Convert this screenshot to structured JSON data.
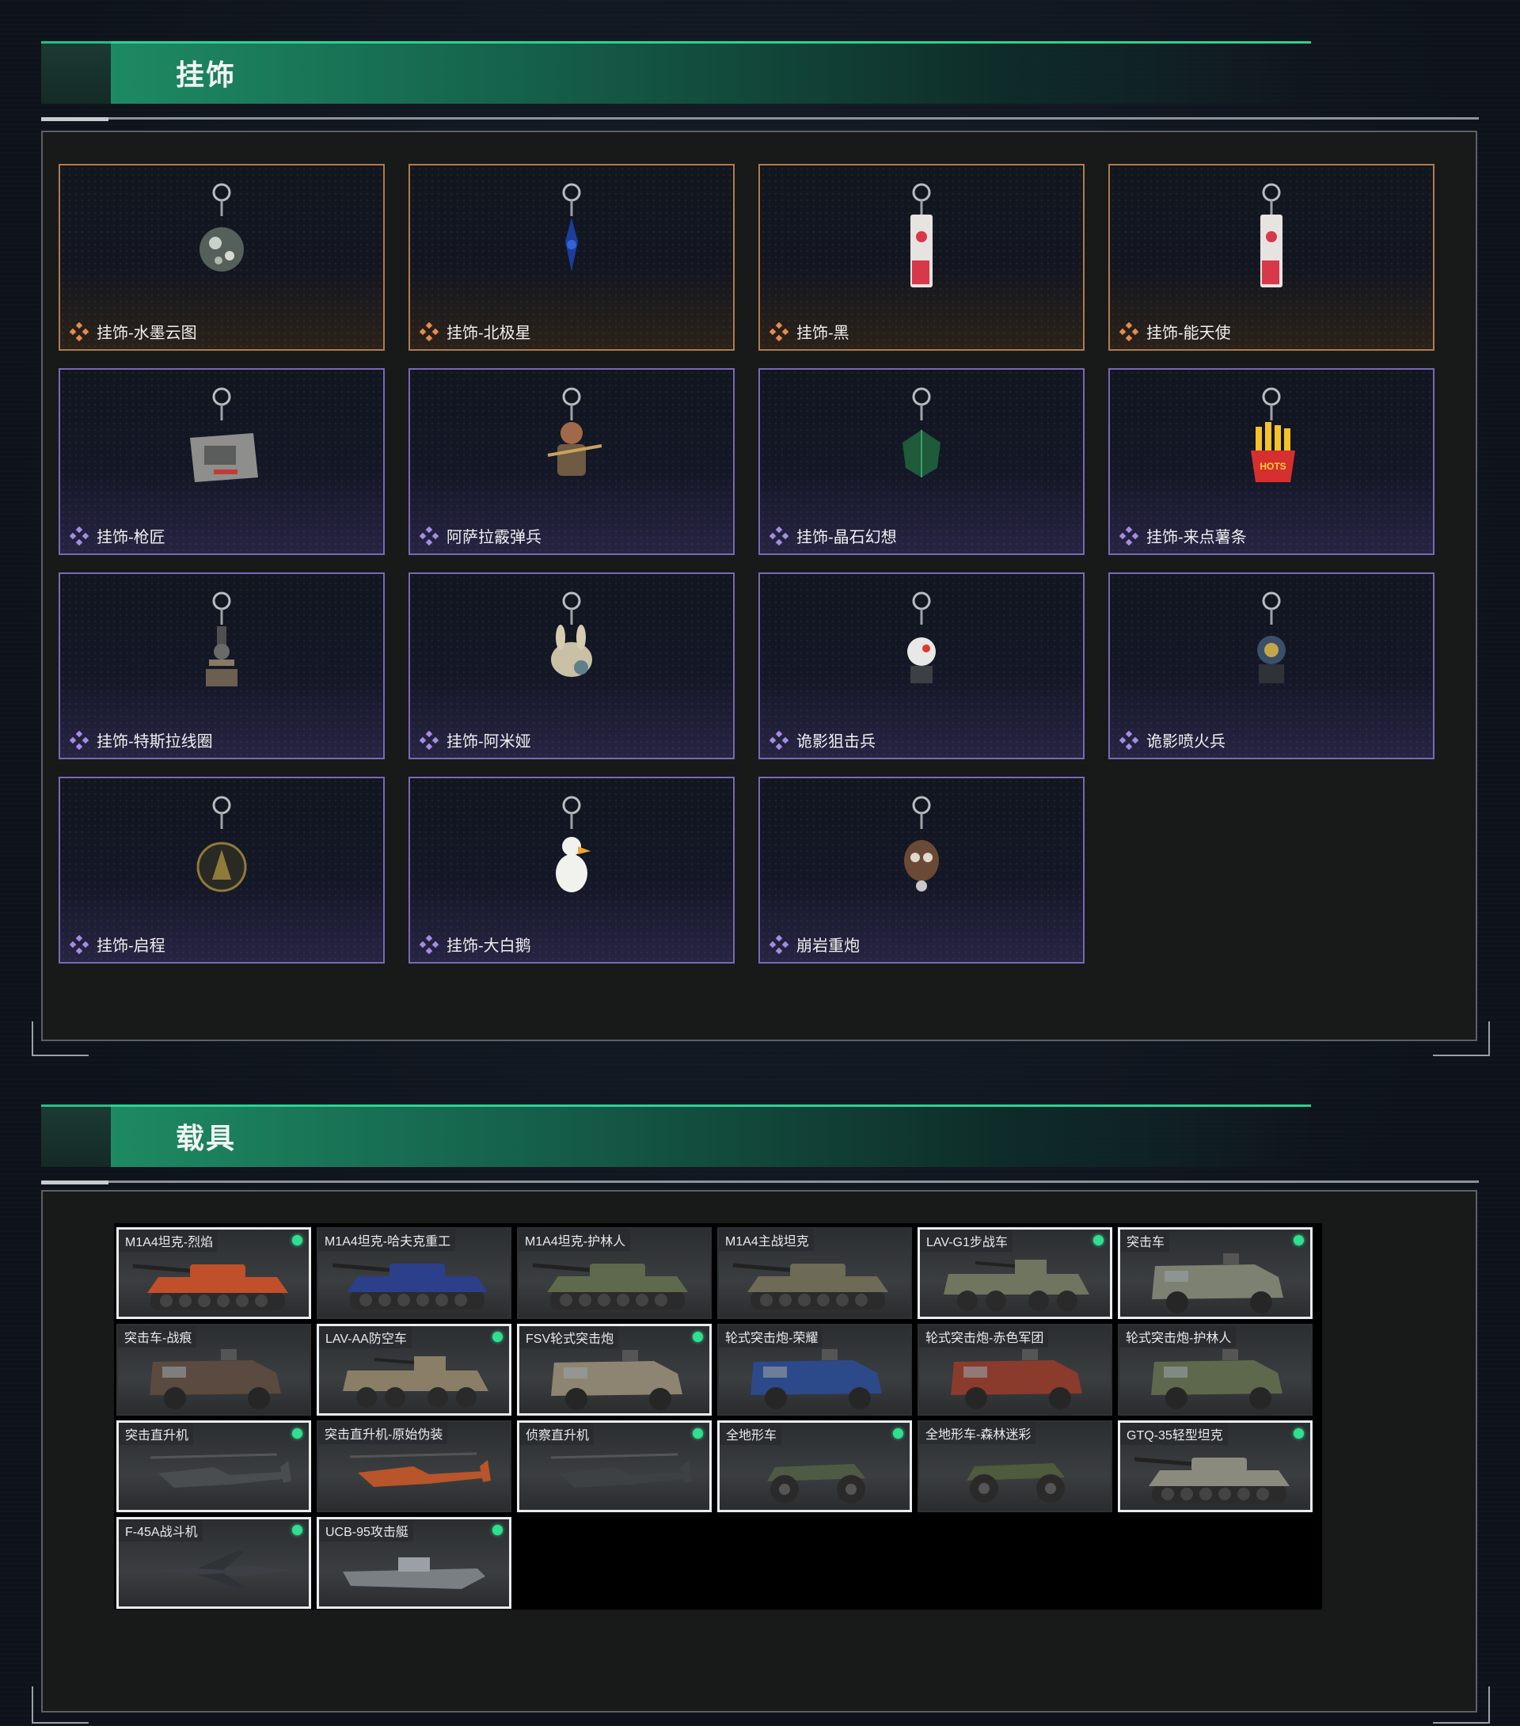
{
  "sections": {
    "pendants": {
      "title": "挂饰"
    },
    "vehicles": {
      "title": "载具"
    }
  },
  "pendants": [
    {
      "name": "挂饰-水墨云图",
      "rarity": "orange",
      "icon": "ball-charm-icon"
    },
    {
      "name": "挂饰-北极星",
      "rarity": "orange",
      "icon": "star-charm-icon"
    },
    {
      "name": "挂饰-黑",
      "rarity": "orange",
      "icon": "tag-charm-icon"
    },
    {
      "name": "挂饰-能天使",
      "rarity": "orange",
      "icon": "tag-charm-icon"
    },
    {
      "name": "挂饰-枪匠",
      "rarity": "purple",
      "icon": "box-charm-icon"
    },
    {
      "name": "阿萨拉霰弹兵",
      "rarity": "purple",
      "icon": "soldier-charm-icon"
    },
    {
      "name": "挂饰-晶石幻想",
      "rarity": "purple",
      "icon": "crystal-charm-icon"
    },
    {
      "name": "挂饰-来点薯条",
      "rarity": "purple",
      "icon": "fries-charm-icon"
    },
    {
      "name": "挂饰-特斯拉线圈",
      "rarity": "purple",
      "icon": "coil-charm-icon"
    },
    {
      "name": "挂饰-阿米娅",
      "rarity": "purple",
      "icon": "bunny-charm-icon"
    },
    {
      "name": "诡影狙击兵",
      "rarity": "purple",
      "icon": "sniper-charm-icon"
    },
    {
      "name": "诡影喷火兵",
      "rarity": "purple",
      "icon": "flamer-charm-icon"
    },
    {
      "name": "挂饰-启程",
      "rarity": "purple",
      "icon": "medal-charm-icon"
    },
    {
      "name": "挂饰-大白鹅",
      "rarity": "purple",
      "icon": "goose-charm-icon"
    },
    {
      "name": "崩岩重炮",
      "rarity": "purple",
      "icon": "gunner-charm-icon"
    }
  ],
  "vehicles": [
    {
      "name": "M1A4坦克-烈焰",
      "selected": true,
      "owned": true,
      "kind": "tank",
      "color": "#c0502a"
    },
    {
      "name": "M1A4坦克-哈夫克重工",
      "selected": false,
      "owned": false,
      "kind": "tank",
      "color": "#2c3f8a"
    },
    {
      "name": "M1A4坦克-护林人",
      "selected": false,
      "owned": false,
      "kind": "tank",
      "color": "#5f6a4c"
    },
    {
      "name": "M1A4主战坦克",
      "selected": false,
      "owned": false,
      "kind": "tank",
      "color": "#6d6a55"
    },
    {
      "name": "LAV-G1步战车",
      "selected": true,
      "owned": true,
      "kind": "apc",
      "color": "#6f755f"
    },
    {
      "name": "突击车",
      "selected": true,
      "owned": true,
      "kind": "truck",
      "color": "#7c8171"
    },
    {
      "name": "突击车-战痕",
      "selected": false,
      "owned": false,
      "kind": "truck",
      "color": "#5a4a40"
    },
    {
      "name": "LAV-AA防空车",
      "selected": true,
      "owned": true,
      "kind": "apc",
      "color": "#8a7f66"
    },
    {
      "name": "FSV轮式突击炮",
      "selected": true,
      "owned": true,
      "kind": "truck",
      "color": "#8d8571"
    },
    {
      "name": "轮式突击炮-荣耀",
      "selected": false,
      "owned": false,
      "kind": "truck",
      "color": "#2c4a8a"
    },
    {
      "name": "轮式突击炮-赤色军团",
      "selected": false,
      "owned": false,
      "kind": "truck",
      "color": "#8a3b2c"
    },
    {
      "name": "轮式突击炮-护林人",
      "selected": false,
      "owned": false,
      "kind": "truck",
      "color": "#5e684d"
    },
    {
      "name": "突击直升机",
      "selected": true,
      "owned": true,
      "kind": "heli",
      "color": "#4a4d50"
    },
    {
      "name": "突击直升机-原始伪装",
      "selected": false,
      "owned": false,
      "kind": "heli",
      "color": "#b8552a"
    },
    {
      "name": "侦察直升机",
      "selected": true,
      "owned": true,
      "kind": "heli",
      "color": "#3e4144"
    },
    {
      "name": "全地形车",
      "selected": true,
      "owned": true,
      "kind": "atv",
      "color": "#4f5a44"
    },
    {
      "name": "全地形车-森林迷彩",
      "selected": false,
      "owned": false,
      "kind": "atv",
      "color": "#505a3c"
    },
    {
      "name": "GTQ-35轻型坦克",
      "selected": true,
      "owned": true,
      "kind": "tank",
      "color": "#8b8a7f"
    },
    {
      "name": "F-45A战斗机",
      "selected": true,
      "owned": true,
      "kind": "jet",
      "color": "#3c3f44"
    },
    {
      "name": "UCB-95攻击艇",
      "selected": true,
      "owned": true,
      "kind": "boat",
      "color": "#7a7f84"
    }
  ],
  "colors": {
    "accent_green": "#2bd394",
    "rarity_orange": "#e78a4e",
    "rarity_purple": "#a48ce6",
    "owned_dot": "#2ee08f"
  }
}
